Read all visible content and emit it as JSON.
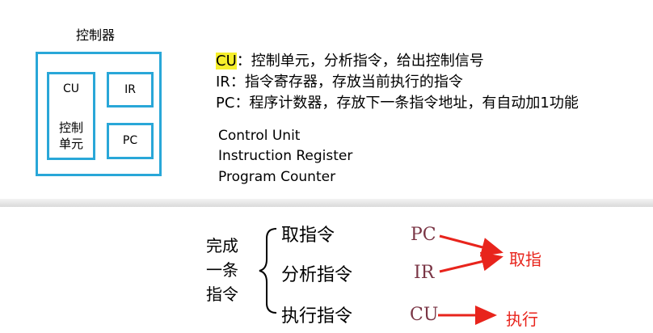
{
  "controller": {
    "title": "控制器",
    "cu_label": "CU",
    "cu_cn_line1": "控制",
    "cu_cn_line2": "单元",
    "ir_label": "IR",
    "pc_label": "PC"
  },
  "descriptions": [
    {
      "abbr": "CU",
      "text": "：控制单元，分析指令，给出控制信号"
    },
    {
      "abbr": "IR",
      "text": "：指令寄存器，存放当前执行的指令"
    },
    {
      "abbr": "PC",
      "text": "：程序计数器，存放下一条指令地址，有自动加1功能"
    }
  ],
  "english": [
    "Control Unit",
    "Instruction Register",
    "Program Counter"
  ],
  "complete_label": [
    "完成",
    "一条",
    "指令"
  ],
  "steps": [
    "取指令",
    "分析指令",
    "执行指令"
  ],
  "registers": [
    "PC",
    "IR",
    "CU"
  ],
  "actions": [
    "取指",
    "执行"
  ],
  "colors": {
    "box_border": "#29a7d8",
    "highlight": "#f6ef2b",
    "register": "#7a3545",
    "arrow": "#e8241c"
  }
}
